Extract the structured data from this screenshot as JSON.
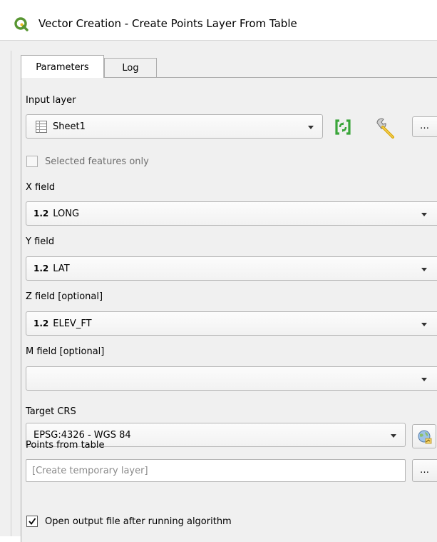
{
  "window": {
    "title": "Vector Creation - Create Points Layer From Table"
  },
  "tabs": [
    {
      "label": "Parameters",
      "active": true
    },
    {
      "label": "Log",
      "active": false
    }
  ],
  "input_layer": {
    "label": "Input layer",
    "value": "Sheet1",
    "icon": "table-layer-icon",
    "selected_only_label": "Selected features only",
    "selected_only_checked": false
  },
  "x_field": {
    "label": "X field",
    "type_tag": "1.2",
    "value": "LONG"
  },
  "y_field": {
    "label": "Y field",
    "type_tag": "1.2",
    "value": "LAT"
  },
  "z_field": {
    "label": "Z field [optional]",
    "type_tag": "1.2",
    "value": "ELEV_FT"
  },
  "m_field": {
    "label": "M field [optional]",
    "value": ""
  },
  "target_crs": {
    "label": "Target CRS",
    "value": "EPSG:4326 - WGS 84"
  },
  "output": {
    "label": "Points from table",
    "placeholder": "[Create temporary layer]",
    "open_after_label": "Open output file after running algorithm",
    "open_after_checked": true
  },
  "buttons": {
    "browse": "…"
  },
  "colors": {
    "qgis_green": "#589632",
    "qgis_yellow": "#eebb22",
    "iterate_green": "#3aa53a"
  }
}
